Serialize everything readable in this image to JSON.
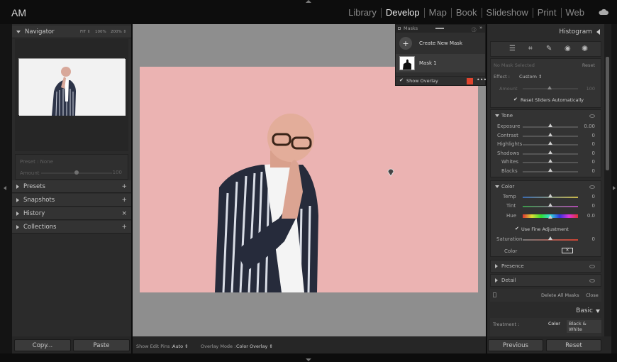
{
  "app": {
    "identity_plate": "AM"
  },
  "modules": [
    "Library",
    "Develop",
    "Map",
    "Book",
    "Slideshow",
    "Print",
    "Web"
  ],
  "active_module": "Develop",
  "navigator": {
    "title": "Navigator",
    "zoom_options": [
      "FIT ⇕",
      "100%",
      "200% ⇕"
    ]
  },
  "preset": {
    "label": "Preset : None",
    "amount_label": "Amount",
    "amount_value": "100",
    "amount_fraction": 0.5
  },
  "left_panels": [
    {
      "title": "Presets",
      "action": "+"
    },
    {
      "title": "Snapshots",
      "action": "+"
    },
    {
      "title": "History",
      "action": "×"
    },
    {
      "title": "Collections",
      "action": "+"
    }
  ],
  "left_buttons": {
    "copy": "Copy...",
    "paste": "Paste"
  },
  "toolbar": {
    "edit_pins_label": "Show Edit Pins :",
    "edit_pins_value": "Auto ⇕",
    "overlay_mode_label": "Overlay Mode :",
    "overlay_mode_value": "Color Overlay ⇕"
  },
  "masks_panel": {
    "title": "Masks",
    "create_label": "Create New Mask",
    "mask_name": "Mask 1",
    "show_overlay_label": "Show Overlay",
    "overlay_color": "#e0442e"
  },
  "histogram": {
    "title": "Histogram"
  },
  "mask_settings": {
    "no_mask": "No Mask Selected",
    "reset": "Reset",
    "effect_label": "Effect :",
    "effect_value": "Custom ⇕",
    "amount_label": "Amount",
    "amount_value": "100",
    "reset_sliders": "Reset Sliders Automatically"
  },
  "tone": {
    "title": "Tone",
    "sliders": [
      {
        "label": "Exposure",
        "value": "0.00"
      },
      {
        "label": "Contrast",
        "value": "0"
      },
      {
        "label": "Highlights",
        "value": "0"
      },
      {
        "label": "Shadows",
        "value": "0"
      },
      {
        "label": "Whites",
        "value": "0"
      },
      {
        "label": "Blacks",
        "value": "0"
      }
    ]
  },
  "color": {
    "title": "Color",
    "temp": {
      "label": "Temp",
      "value": "0"
    },
    "tint": {
      "label": "Tint",
      "value": "0"
    },
    "hue": {
      "label": "Hue",
      "value": "0.0"
    },
    "fine_adjust": "Use Fine Adjustment",
    "saturation": {
      "label": "Saturation",
      "value": "0"
    },
    "color_label": "Color"
  },
  "collapsed": [
    {
      "title": "Presence"
    },
    {
      "title": "Detail"
    }
  ],
  "mask_footer": {
    "delete": "Delete All Masks",
    "close": "Close"
  },
  "basic": {
    "title": "Basic",
    "treatment_label": "Treatment :",
    "color": "Color",
    "bw": "Black & White"
  },
  "right_buttons": {
    "previous": "Previous",
    "reset": "Reset"
  }
}
